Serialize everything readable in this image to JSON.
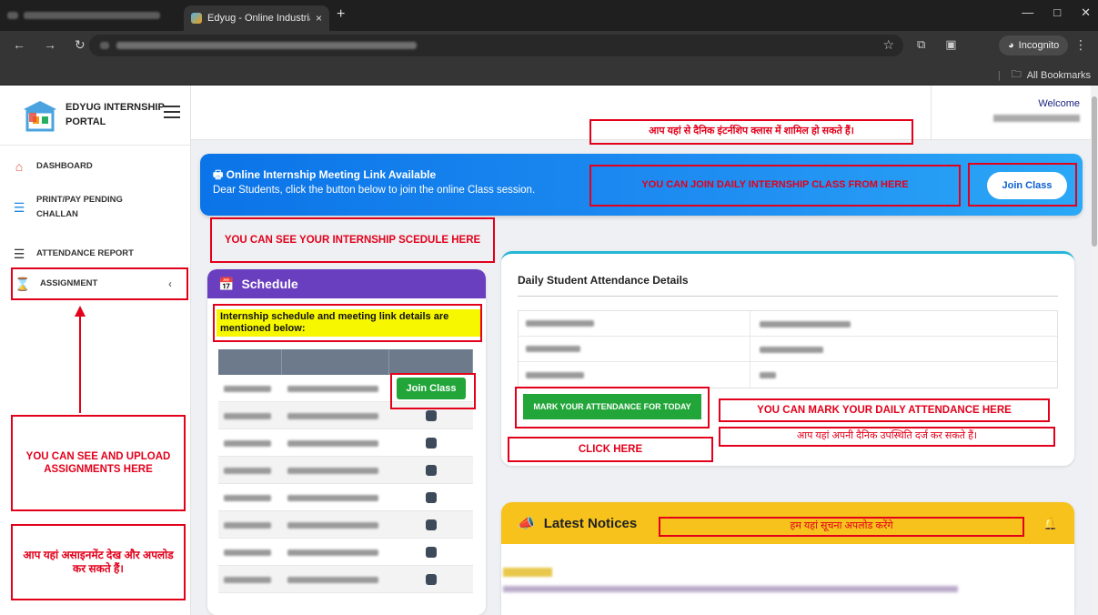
{
  "browser": {
    "tab_title": "Edyug - Online Industrial Traini",
    "tab_close": "×",
    "new_tab": "+",
    "incognito_label": "Incognito",
    "bookmarks_label": "All Bookmarks"
  },
  "sidebar": {
    "brand": "EDYUG INTERNSHIP PORTAL",
    "items": [
      {
        "label": "DASHBOARD",
        "icon": "home-icon"
      },
      {
        "label": "PRINT/PAY PENDING CHALLAN",
        "icon": "list-ordered-icon"
      },
      {
        "label": "ATTENDANCE REPORT",
        "icon": "list-ordered-icon"
      },
      {
        "label": "ASSIGNMENT",
        "icon": "hourglass-icon"
      }
    ]
  },
  "header": {
    "welcome": "Welcome"
  },
  "banner": {
    "title": "Online Internship Meeting Link Available",
    "subtitle": "Dear Students, click the button below to join the online Class session.",
    "join_label": "Join Class"
  },
  "schedule": {
    "title": "Schedule",
    "note": "Internship schedule and meeting link details are mentioned below:",
    "join_label": "Join Class"
  },
  "attendance": {
    "title": "Daily Student Attendance Details",
    "mark_label": "MARK YOUR ATTENDANCE FOR TODAY"
  },
  "notices": {
    "title": "Latest Notices"
  },
  "annotations": {
    "hindi_join": "आप यहां से दैनिक इंटर्नशिप क्लास में शामिल हो सकते हैं।",
    "join_daily": "YOU CAN JOIN DAILY INTERNSHIP CLASS FROM HERE",
    "see_schedule": "YOU CAN SEE YOUR INTERNSHIP SCEDULE HERE",
    "mark_daily": "YOU CAN MARK YOUR DAILY ATTENDANCE HERE",
    "hindi_mark": "आप यहां अपनी दैनिक उपस्थिति दर्ज कर सकते हैं।",
    "click_here": "CLICK HERE",
    "see_upload": "YOU CAN SEE AND UPLOAD ASSIGNMENTS HERE",
    "hindi_assign": "आप यहां असाइनमेंट देख और अपलोड कर सकते हैं।",
    "hindi_notice": "हम यहां सूचना अपलोड करेंगे"
  },
  "colors": {
    "annotation_red": "#e3001b",
    "banner_blue": "#0b74e8",
    "schedule_purple": "#6a3fbf",
    "notice_yellow": "#f6c21b",
    "button_green": "#22a63a"
  }
}
